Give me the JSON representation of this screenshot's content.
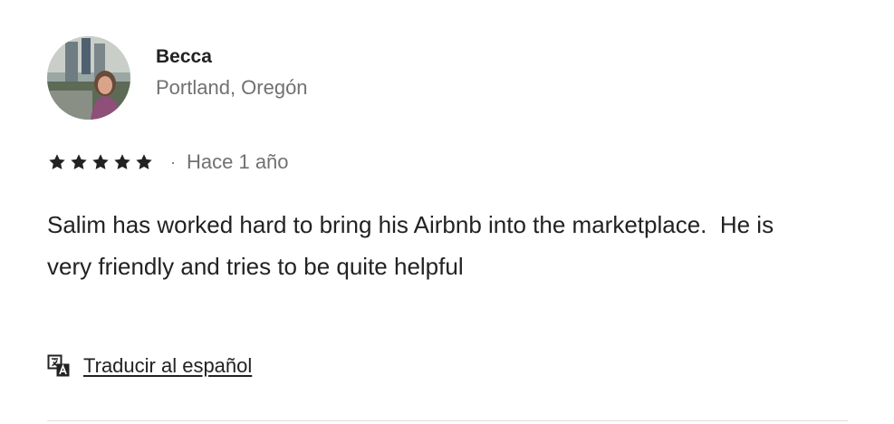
{
  "review": {
    "author": {
      "name": "Becca",
      "location": "Portland, Oregón",
      "avatar_icon": "user-photo"
    },
    "rating": {
      "stars": 5,
      "max": 5,
      "star_icon": "star-icon",
      "separator": "·"
    },
    "time_ago": "Hace 1 año",
    "text": "Salim has worked hard to bring his Airbnb into the marketplace.  He is very friendly and tries to be quite helpful",
    "translate": {
      "label": "Traducir al español",
      "icon": "translate-icon"
    }
  },
  "colors": {
    "primary_text": "#222222",
    "secondary_text": "#717171",
    "divider": "#dddddd"
  }
}
